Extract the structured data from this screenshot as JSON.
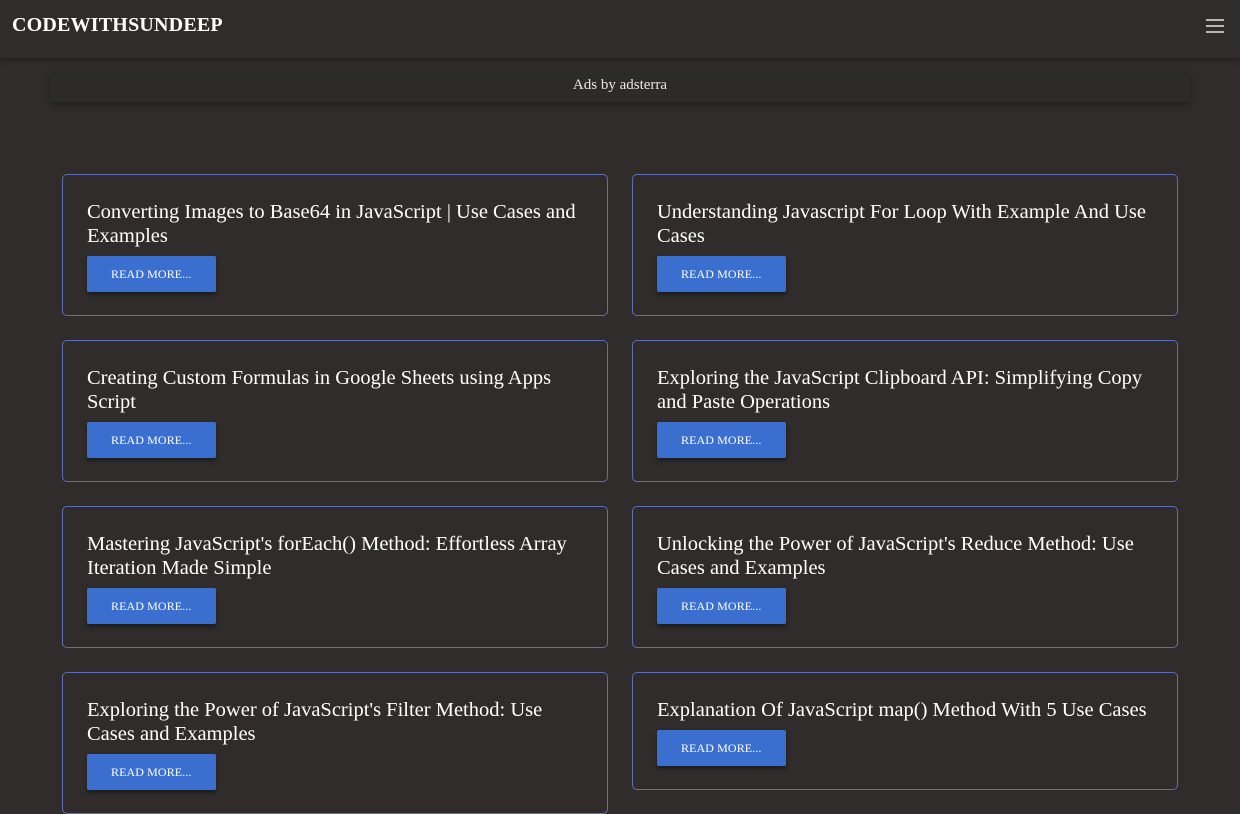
{
  "header": {
    "brand": "CODEWITHSUNDEEP",
    "menu_icon": "hamburger-menu-icon"
  },
  "ad": {
    "text": "Ads by adsterra"
  },
  "posts": [
    {
      "title": "Converting Images to Base64 in JavaScript | Use Cases and Examples",
      "button": "READ MORE..."
    },
    {
      "title": "Understanding Javascript For Loop With Example And Use Cases",
      "button": "READ MORE..."
    },
    {
      "title": "Creating Custom Formulas in Google Sheets using Apps Script",
      "button": "READ MORE..."
    },
    {
      "title": "Exploring the JavaScript Clipboard API: Simplifying Copy and Paste Operations",
      "button": "READ MORE..."
    },
    {
      "title": "Mastering JavaScript's forEach() Method: Effortless Array Iteration Made Simple",
      "button": "READ MORE..."
    },
    {
      "title": "Unlocking the Power of JavaScript's Reduce Method: Use Cases and Examples",
      "button": "READ MORE..."
    },
    {
      "title": "Exploring the Power of JavaScript's Filter Method: Use Cases and Examples",
      "button": "READ MORE..."
    },
    {
      "title": "Explanation Of JavaScript map() Method With 5 Use Cases",
      "button": "READ MORE..."
    }
  ],
  "colors": {
    "background": "#302c2c",
    "card_border": "#5d6fb3",
    "button": "#3a6fd0"
  }
}
